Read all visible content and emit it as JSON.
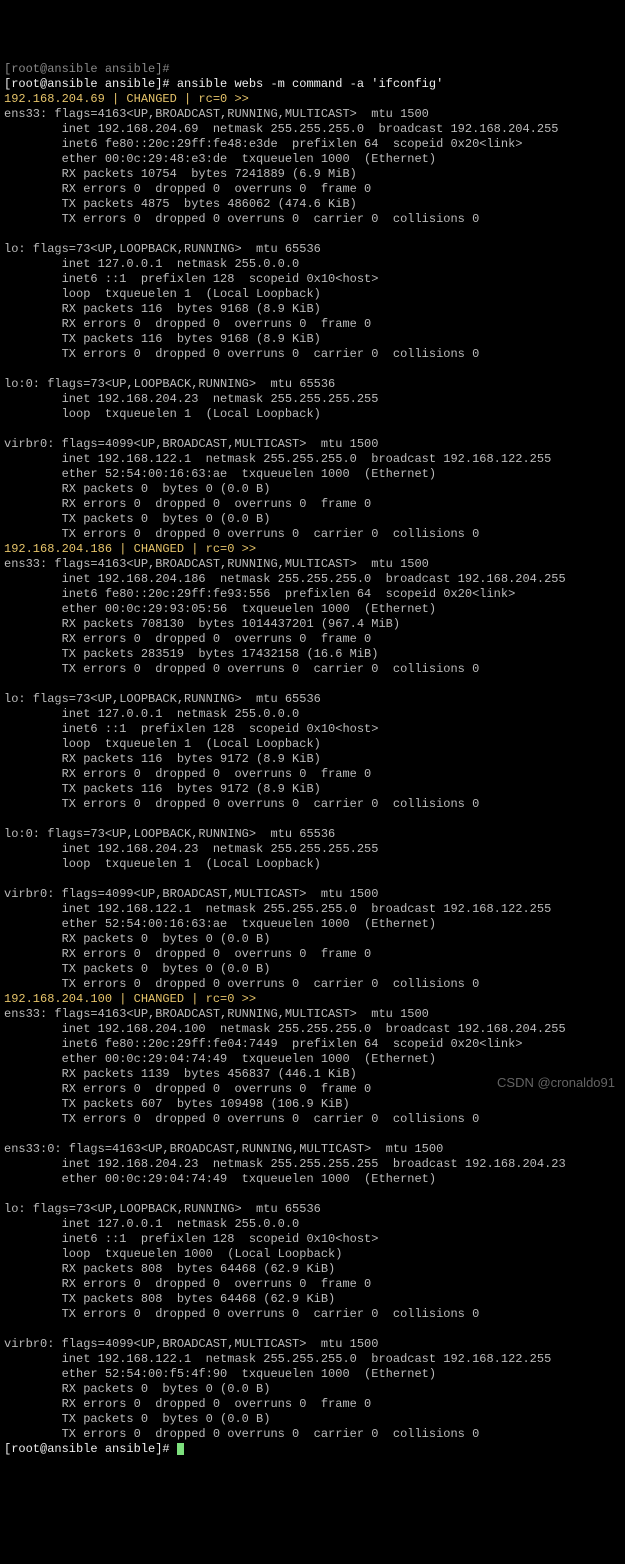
{
  "prompt_line0": "[root@ansible ansible]#",
  "prompt_line1_prefix": "[root@ansible ansible]# ",
  "command": "ansible webs -m command -a 'ifconfig'",
  "host1_header": "192.168.204.69 | CHANGED | rc=0 >>",
  "host1_body": "ens33: flags=4163<UP,BROADCAST,RUNNING,MULTICAST>  mtu 1500\n        inet 192.168.204.69  netmask 255.255.255.0  broadcast 192.168.204.255\n        inet6 fe80::20c:29ff:fe48:e3de  prefixlen 64  scopeid 0x20<link>\n        ether 00:0c:29:48:e3:de  txqueuelen 1000  (Ethernet)\n        RX packets 10754  bytes 7241889 (6.9 MiB)\n        RX errors 0  dropped 0  overruns 0  frame 0\n        TX packets 4875  bytes 486062 (474.6 KiB)\n        TX errors 0  dropped 0 overruns 0  carrier 0  collisions 0\n\nlo: flags=73<UP,LOOPBACK,RUNNING>  mtu 65536\n        inet 127.0.0.1  netmask 255.0.0.0\n        inet6 ::1  prefixlen 128  scopeid 0x10<host>\n        loop  txqueuelen 1  (Local Loopback)\n        RX packets 116  bytes 9168 (8.9 KiB)\n        RX errors 0  dropped 0  overruns 0  frame 0\n        TX packets 116  bytes 9168 (8.9 KiB)\n        TX errors 0  dropped 0 overruns 0  carrier 0  collisions 0\n\nlo:0: flags=73<UP,LOOPBACK,RUNNING>  mtu 65536\n        inet 192.168.204.23  netmask 255.255.255.255\n        loop  txqueuelen 1  (Local Loopback)\n\nvirbr0: flags=4099<UP,BROADCAST,MULTICAST>  mtu 1500\n        inet 192.168.122.1  netmask 255.255.255.0  broadcast 192.168.122.255\n        ether 52:54:00:16:63:ae  txqueuelen 1000  (Ethernet)\n        RX packets 0  bytes 0 (0.0 B)\n        RX errors 0  dropped 0  overruns 0  frame 0\n        TX packets 0  bytes 0 (0.0 B)\n        TX errors 0  dropped 0 overruns 0  carrier 0  collisions 0",
  "host2_header": "192.168.204.186 | CHANGED | rc=0 >>",
  "host2_body": "ens33: flags=4163<UP,BROADCAST,RUNNING,MULTICAST>  mtu 1500\n        inet 192.168.204.186  netmask 255.255.255.0  broadcast 192.168.204.255\n        inet6 fe80::20c:29ff:fe93:556  prefixlen 64  scopeid 0x20<link>\n        ether 00:0c:29:93:05:56  txqueuelen 1000  (Ethernet)\n        RX packets 708130  bytes 1014437201 (967.4 MiB)\n        RX errors 0  dropped 0  overruns 0  frame 0\n        TX packets 283519  bytes 17432158 (16.6 MiB)\n        TX errors 0  dropped 0 overruns 0  carrier 0  collisions 0\n\nlo: flags=73<UP,LOOPBACK,RUNNING>  mtu 65536\n        inet 127.0.0.1  netmask 255.0.0.0\n        inet6 ::1  prefixlen 128  scopeid 0x10<host>\n        loop  txqueuelen 1  (Local Loopback)\n        RX packets 116  bytes 9172 (8.9 KiB)\n        RX errors 0  dropped 0  overruns 0  frame 0\n        TX packets 116  bytes 9172 (8.9 KiB)\n        TX errors 0  dropped 0 overruns 0  carrier 0  collisions 0\n\nlo:0: flags=73<UP,LOOPBACK,RUNNING>  mtu 65536\n        inet 192.168.204.23  netmask 255.255.255.255\n        loop  txqueuelen 1  (Local Loopback)\n\nvirbr0: flags=4099<UP,BROADCAST,MULTICAST>  mtu 1500\n        inet 192.168.122.1  netmask 255.255.255.0  broadcast 192.168.122.255\n        ether 52:54:00:16:63:ae  txqueuelen 1000  (Ethernet)\n        RX packets 0  bytes 0 (0.0 B)\n        RX errors 0  dropped 0  overruns 0  frame 0\n        TX packets 0  bytes 0 (0.0 B)\n        TX errors 0  dropped 0 overruns 0  carrier 0  collisions 0",
  "host3_header": "192.168.204.100 | CHANGED | rc=0 >>",
  "host3_body": "ens33: flags=4163<UP,BROADCAST,RUNNING,MULTICAST>  mtu 1500\n        inet 192.168.204.100  netmask 255.255.255.0  broadcast 192.168.204.255\n        inet6 fe80::20c:29ff:fe04:7449  prefixlen 64  scopeid 0x20<link>\n        ether 00:0c:29:04:74:49  txqueuelen 1000  (Ethernet)\n        RX packets 1139  bytes 456837 (446.1 KiB)\n        RX errors 0  dropped 0  overruns 0  frame 0\n        TX packets 607  bytes 109498 (106.9 KiB)\n        TX errors 0  dropped 0 overruns 0  carrier 0  collisions 0\n\nens33:0: flags=4163<UP,BROADCAST,RUNNING,MULTICAST>  mtu 1500\n        inet 192.168.204.23  netmask 255.255.255.255  broadcast 192.168.204.23\n        ether 00:0c:29:04:74:49  txqueuelen 1000  (Ethernet)\n\nlo: flags=73<UP,LOOPBACK,RUNNING>  mtu 65536\n        inet 127.0.0.1  netmask 255.0.0.0\n        inet6 ::1  prefixlen 128  scopeid 0x10<host>\n        loop  txqueuelen 1000  (Local Loopback)\n        RX packets 808  bytes 64468 (62.9 KiB)\n        RX errors 0  dropped 0  overruns 0  frame 0\n        TX packets 808  bytes 64468 (62.9 KiB)\n        TX errors 0  dropped 0 overruns 0  carrier 0  collisions 0\n\nvirbr0: flags=4099<UP,BROADCAST,MULTICAST>  mtu 1500\n        inet 192.168.122.1  netmask 255.255.255.0  broadcast 192.168.122.255\n        ether 52:54:00:f5:4f:90  txqueuelen 1000  (Ethernet)\n        RX packets 0  bytes 0 (0.0 B)\n        RX errors 0  dropped 0  overruns 0  frame 0\n        TX packets 0  bytes 0 (0.0 B)\n        TX errors 0  dropped 0 overruns 0  carrier 0  collisions 0",
  "prompt_end": "[root@ansible ansible]# ",
  "watermark": "CSDN @cronaldo91"
}
